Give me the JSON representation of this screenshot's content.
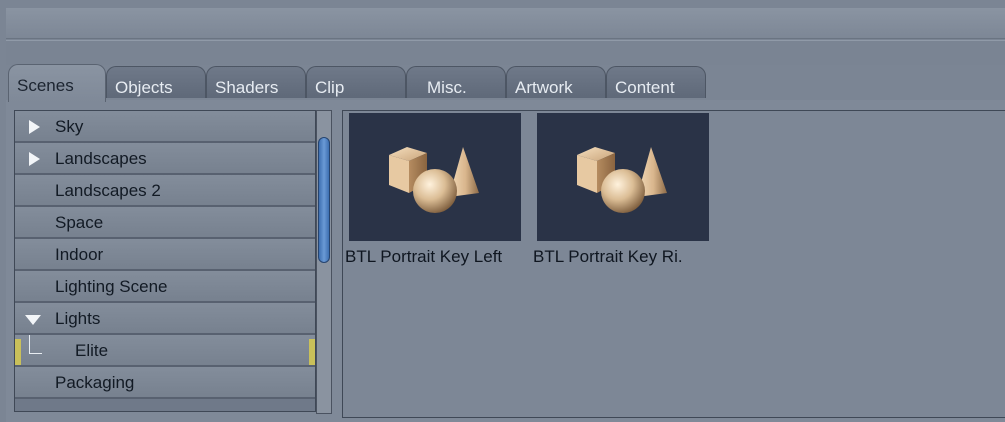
{
  "tabs": [
    {
      "label": "Scenes",
      "active": true
    },
    {
      "label": "Objects",
      "active": false
    },
    {
      "label": "Shaders",
      "active": false
    },
    {
      "label": "Clip",
      "active": false
    },
    {
      "label": "Misc.",
      "active": false
    },
    {
      "label": "Artwork",
      "active": false
    },
    {
      "label": "Content",
      "active": false
    }
  ],
  "sidebar": {
    "items": [
      {
        "label": "Sky",
        "expander": "collapsed"
      },
      {
        "label": "Landscapes",
        "expander": "collapsed"
      },
      {
        "label": "Landscapes 2"
      },
      {
        "label": "Space"
      },
      {
        "label": "Indoor"
      },
      {
        "label": "Lighting Scene"
      },
      {
        "label": "Lights",
        "expander": "expanded"
      },
      {
        "label": "Elite",
        "child": true
      },
      {
        "label": "Packaging"
      }
    ]
  },
  "content": {
    "items": [
      {
        "label": "BTL Portrait Key Left",
        "icon": "primitives-icon"
      },
      {
        "label": "BTL Portrait Key Ri.",
        "icon": "primitives-icon"
      }
    ]
  },
  "colors": {
    "scroll_thumb": "#4a7fc4",
    "highlight_marker": "#c9c05a",
    "thumb_background": "#2a3347"
  }
}
